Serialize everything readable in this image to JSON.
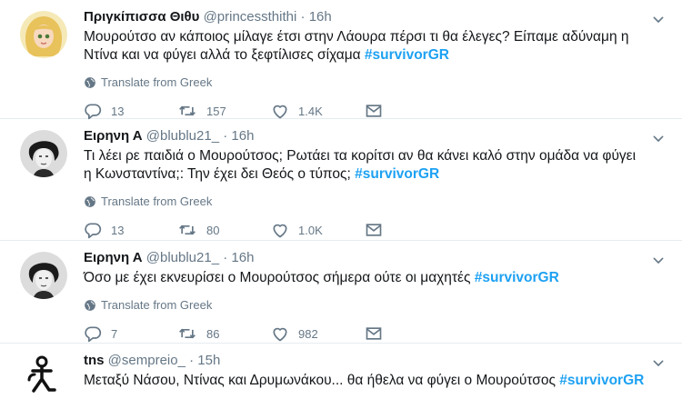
{
  "tweets": [
    {
      "name": "Πριγκίπισσα Θιθυ",
      "handle": "@princessthithi",
      "dot": "·",
      "time": "16h",
      "text": "Μουρούτσο αν κάποιος μίλαγε έτσι στην Λάουρα πέρσι τι θα έλεγες? Είπαμε αδύναμη η Ντίνα και να φύγει αλλά το ξεφτίλισες σίχαμα",
      "hashtag": "#survivorGR",
      "translate": "Translate from Greek",
      "replies": "13",
      "retweets": "157",
      "likes": "1.4K"
    },
    {
      "name": "Ειρηνη Α",
      "handle": "@blublu21_",
      "dot": "·",
      "time": "16h",
      "text": "Τι λέει ρε παιδιά ο Μουρούτσος; Ρωτάει τα κορίτσι αν θα κάνει καλό στην ομάδα να φύγει η Κωνσταντίνα;: Την έχει δει Θεός ο τύπος;",
      "hashtag": "#survivorGR",
      "translate": "Translate from Greek",
      "replies": "13",
      "retweets": "80",
      "likes": "1.0K"
    },
    {
      "name": "Ειρηνη Α",
      "handle": "@blublu21_",
      "dot": "·",
      "time": "16h",
      "text": "Όσο με έχει εκνευρίσει ο Μουρούτσος σήμερα ούτε οι μαχητές",
      "hashtag": "#survivorGR",
      "translate": "Translate from Greek",
      "replies": "7",
      "retweets": "86",
      "likes": "982"
    },
    {
      "name": "tns",
      "handle": "@sempreio_",
      "dot": "·",
      "time": "15h",
      "text": "Μεταξύ Νάσου, Ντίνας και Δρυμωνάκου... θα ήθελα να φύγει ο Μουρούτσος",
      "hashtag": "#survivorGR"
    }
  ],
  "colors": {
    "hashtag": "#1da1f2",
    "muted": "#657786",
    "divider": "#e6ecf0"
  },
  "icons": [
    "reply-icon",
    "retweet-icon",
    "like-icon",
    "message-icon",
    "globe-icon",
    "chevron-down-icon"
  ]
}
